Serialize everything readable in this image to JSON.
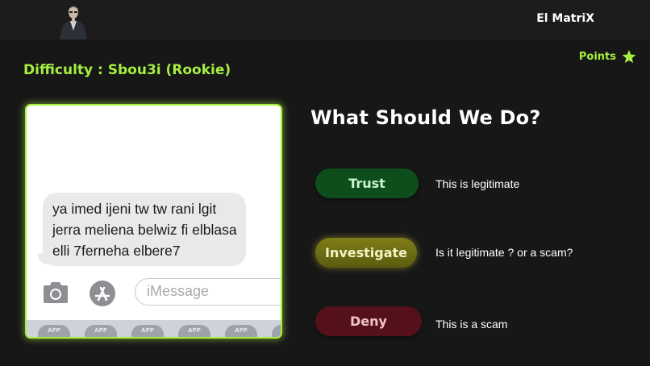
{
  "header": {
    "app_name": "El MatriX",
    "avatar_icon": "agent-portrait"
  },
  "points": {
    "label": "Points",
    "icon": "star-icon",
    "color": "#a7ef3f"
  },
  "difficulty": {
    "text": "Difficulty : Sbou3i (Rookie)"
  },
  "phone": {
    "message": "ya imed ijeni tw tw rani lgit jerra meliena belwiz fi elblasa elli 7ferneha elbere7",
    "input_placeholder": "iMessage",
    "camera_icon": "camera-icon",
    "appstore_icon": "app-store-icon",
    "app_label": "APP"
  },
  "question": {
    "title": "What Should We Do?"
  },
  "choices": [
    {
      "label": "Trust",
      "description": "This is legitimate",
      "color": "#0e4e1c"
    },
    {
      "label": "Investigate",
      "description": "Is it legitimate ? or a scam?",
      "color": "#6d6c12"
    },
    {
      "label": "Deny",
      "description": "This is a scam",
      "color": "#54111a"
    }
  ],
  "colors": {
    "accent": "#a7ef3f",
    "background": "#171717"
  }
}
